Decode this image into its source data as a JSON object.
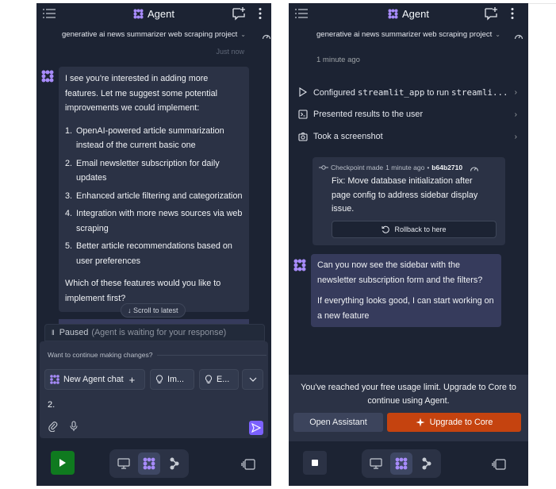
{
  "left": {
    "header": {
      "title": "Agent"
    },
    "project": {
      "name": "generative ai news summarizer web scraping project",
      "chevron": "⌄"
    },
    "timestamp": "Just now",
    "message": {
      "intro": "I see you're interested in adding more features. Let me suggest some potential improvements we could implement:",
      "items": [
        {
          "num": "1.",
          "text": "OpenAI-powered article summarization instead of the current basic one"
        },
        {
          "num": "2.",
          "text": "Email newsletter subscription for daily updates"
        },
        {
          "num": "3.",
          "text": "Enhanced article filtering and categorization"
        },
        {
          "num": "4.",
          "text": "Integration with more news sources via web scraping"
        },
        {
          "num": "5.",
          "text": "Better article recommendations based on user preferences"
        }
      ],
      "outro": "Which of these features would you like to implement first?"
    },
    "scroll_pill": "↓ Scroll to latest",
    "paused": {
      "label": "Paused",
      "detail": "(Agent is waiting for your response)"
    },
    "continue_label": "Want to continue making changes?",
    "chips": {
      "new_agent": "New Agent chat",
      "chip2": "Im...",
      "chip3": "E..."
    },
    "input_value": "2.",
    "colors": {
      "run": "#0f7a1f",
      "send": "#7b61ff"
    }
  },
  "right": {
    "header": {
      "title": "Agent"
    },
    "project": {
      "name": "generative ai news summarizer web scraping project",
      "chevron": "⌄"
    },
    "timestamp": "1 minute ago",
    "actions": [
      {
        "icon": "play-icon",
        "prefix": "Configured ",
        "code": "streamlit_app",
        "mid": " to run ",
        "code2": "streamli..."
      },
      {
        "icon": "terminal-icon",
        "text": "Presented results to the user"
      },
      {
        "icon": "camera-icon",
        "text": "Took a screenshot"
      }
    ],
    "checkpoint": {
      "label": "Checkpoint made",
      "time": "1 minute ago",
      "sep": "•",
      "hash": "b64b2710",
      "message": "Fix: Move database initialization after page config to address sidebar display issue.",
      "rollback": "Rollback to here"
    },
    "message": {
      "p1": "Can you now see the sidebar with the newsletter subscription form and the filters?",
      "p2": "If everything looks good, I can start working on a new feature"
    },
    "limit": {
      "text": "You've reached your free usage limit. Upgrade to Core to continue using Agent.",
      "open": "Open Assistant",
      "upgrade": "Upgrade to Core"
    },
    "colors": {
      "upgrade": "#c5430f"
    }
  }
}
